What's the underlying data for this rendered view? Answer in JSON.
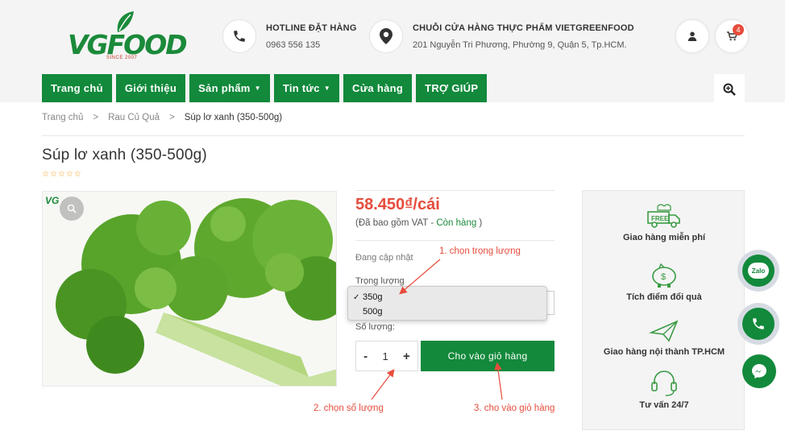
{
  "logo": {
    "text": "VGFOOD",
    "since": "SINCE 2007"
  },
  "header": {
    "hotline": {
      "title": "HOTLINE ĐẶT HÀNG",
      "value": "0963 556 135"
    },
    "store": {
      "title": "CHUỖI CỬA HÀNG THỰC PHẨM VIETGREENFOOD",
      "address": "201 Nguyễn Tri Phương, Phường 9, Quận 5, Tp.HCM."
    },
    "cart_count": "4"
  },
  "nav": {
    "items": [
      {
        "label": "Trang chủ",
        "dropdown": false
      },
      {
        "label": "Giới thiệu",
        "dropdown": false
      },
      {
        "label": "Sản phẩm",
        "dropdown": true
      },
      {
        "label": "Tin tức",
        "dropdown": true
      },
      {
        "label": "Cửa hàng",
        "dropdown": false
      },
      {
        "label": "TRỢ GIÚP",
        "dropdown": false
      }
    ]
  },
  "breadcrumb": {
    "home": "Trang chủ",
    "category": "Rau Củ Quả",
    "current": "Súp lơ xanh (350-500g)",
    "sep": ">"
  },
  "product": {
    "title": "Súp lơ xanh (350-500g)",
    "stars": "☆☆☆☆☆",
    "mini_logo": "VG",
    "price": "58.450₫/cái",
    "vat_prefix": "(Đã bao gồm VAT - ",
    "stock": "Còn hàng",
    "vat_suffix": " )",
    "updating": "Đang cập nhật",
    "weight_label": "Trọng lượng",
    "weight_options": [
      "350g",
      "500g"
    ],
    "weight_selected": "350g",
    "qty_label": "Số lượng:",
    "qty_minus": "-",
    "qty_value": "1",
    "qty_plus": "+",
    "add_to_cart": "Cho vào giỏ hàng"
  },
  "annotations": {
    "a1": "1. chọn trọng lượng",
    "a2": "2. chọn số lượng",
    "a3": "3. cho vào giỏ hàng"
  },
  "services": {
    "free_badge": "FREE",
    "items": [
      {
        "label": "Giao hàng miễn phí",
        "icon": "free-truck-icon"
      },
      {
        "label": "Tích điểm đổi quà",
        "icon": "piggy-bank-icon"
      },
      {
        "label": "Giao hàng nội thành TP.HCM",
        "icon": "paper-plane-icon"
      },
      {
        "label": "Tư vấn 24/7",
        "icon": "headset-icon"
      }
    ]
  },
  "floating": {
    "zalo": "Zalo"
  },
  "colors": {
    "brand_green": "#12893b",
    "price_red": "#e74c3c",
    "annotation_red": "#e74c3c"
  }
}
